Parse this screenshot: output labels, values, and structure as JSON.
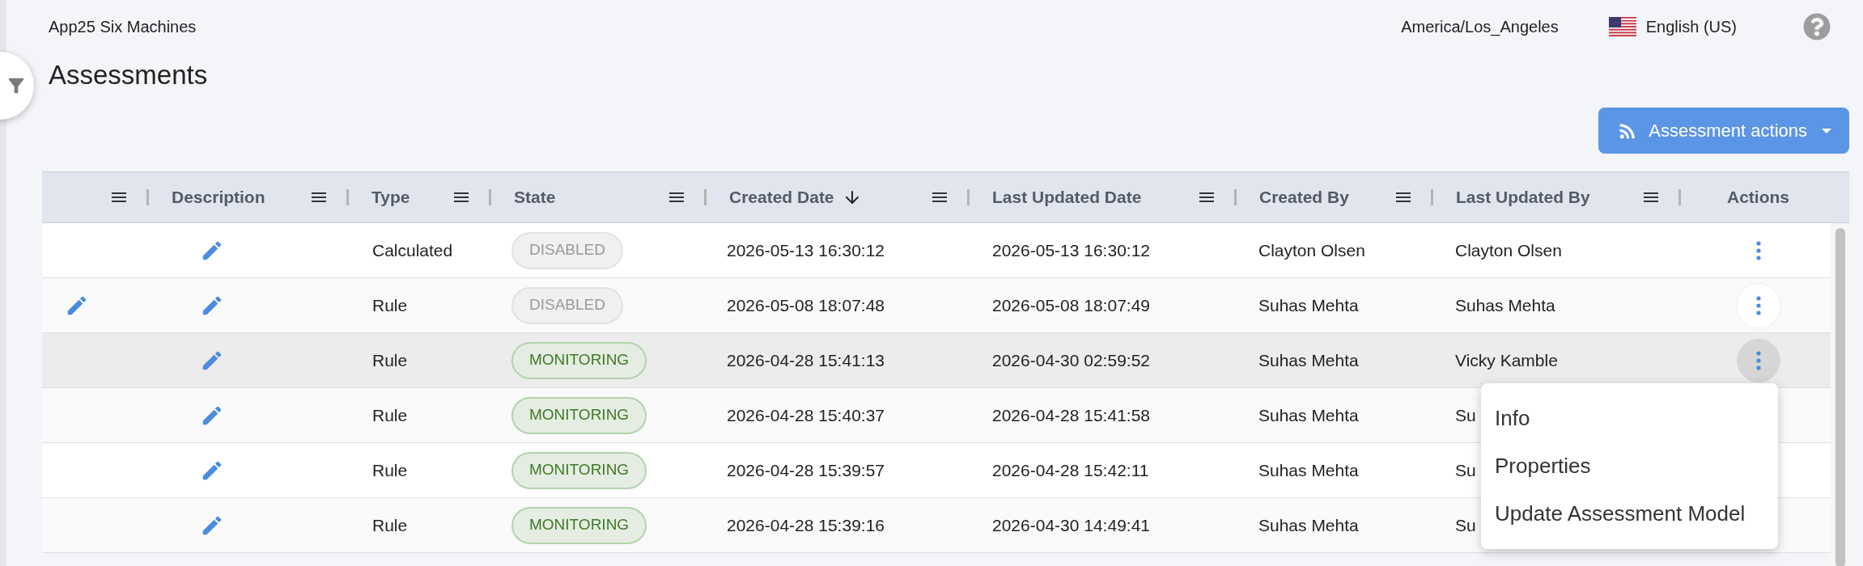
{
  "header": {
    "app_name": "App25 Six Machines",
    "timezone": "America/Los_Angeles",
    "language": "English (US)"
  },
  "page_title": "Assessments",
  "actions_button": {
    "label": "Assessment actions"
  },
  "table": {
    "columns": [
      {
        "kind": "data"
      },
      {
        "kind": "data",
        "label": "Description"
      },
      {
        "kind": "data",
        "label": "Type"
      },
      {
        "kind": "data",
        "label": "State"
      },
      {
        "kind": "data",
        "label": "Created Date",
        "sorted": true
      },
      {
        "kind": "data",
        "label": "Last Updated Date"
      },
      {
        "kind": "data",
        "label": "Created By"
      },
      {
        "kind": "data",
        "label": "Last Updated By"
      },
      {
        "kind": "actions",
        "label": "Actions"
      }
    ],
    "rows": [
      {
        "row_edit": false,
        "type": "Calculated",
        "state": {
          "label": "DISABLED",
          "kind": "disabled"
        },
        "created_date": "2026-05-13 16:30:12",
        "last_updated_date": "2026-05-13 16:30:12",
        "created_by": "Clayton Olsen",
        "last_updated_by": "Clayton Olsen",
        "selected": false,
        "hovered": false,
        "menu_open": false
      },
      {
        "row_edit": true,
        "type": "Rule",
        "state": {
          "label": "DISABLED",
          "kind": "disabled"
        },
        "created_date": "2026-05-08 18:07:48",
        "last_updated_date": "2026-05-08 18:07:49",
        "created_by": "Suhas Mehta",
        "last_updated_by": "Suhas Mehta",
        "selected": false,
        "hovered": true,
        "menu_open": false
      },
      {
        "row_edit": false,
        "type": "Rule",
        "state": {
          "label": "MONITORING",
          "kind": "monitoring"
        },
        "created_date": "2026-04-28 15:41:13",
        "last_updated_date": "2026-04-30 02:59:52",
        "created_by": "Suhas Mehta",
        "last_updated_by": "Vicky Kamble",
        "selected": true,
        "hovered": false,
        "menu_open": true
      },
      {
        "row_edit": false,
        "type": "Rule",
        "state": {
          "label": "MONITORING",
          "kind": "monitoring"
        },
        "created_date": "2026-04-28 15:40:37",
        "last_updated_date": "2026-04-28 15:41:58",
        "created_by": "Suhas Mehta",
        "last_updated_by": "Su",
        "selected": false
      },
      {
        "row_edit": false,
        "type": "Rule",
        "state": {
          "label": "MONITORING",
          "kind": "monitoring"
        },
        "created_date": "2026-04-28 15:39:57",
        "last_updated_date": "2026-04-28 15:42:11",
        "created_by": "Suhas Mehta",
        "last_updated_by": "Su",
        "selected": false
      },
      {
        "row_edit": false,
        "type": "Rule",
        "state": {
          "label": "MONITORING",
          "kind": "monitoring"
        },
        "created_date": "2026-04-28 15:39:16",
        "last_updated_date": "2026-04-30 14:49:41",
        "created_by": "Suhas Mehta",
        "last_updated_by": "Su",
        "selected": false
      }
    ]
  },
  "context_menu": {
    "items": [
      "Info",
      "Properties",
      "Update Assessment Model"
    ]
  }
}
